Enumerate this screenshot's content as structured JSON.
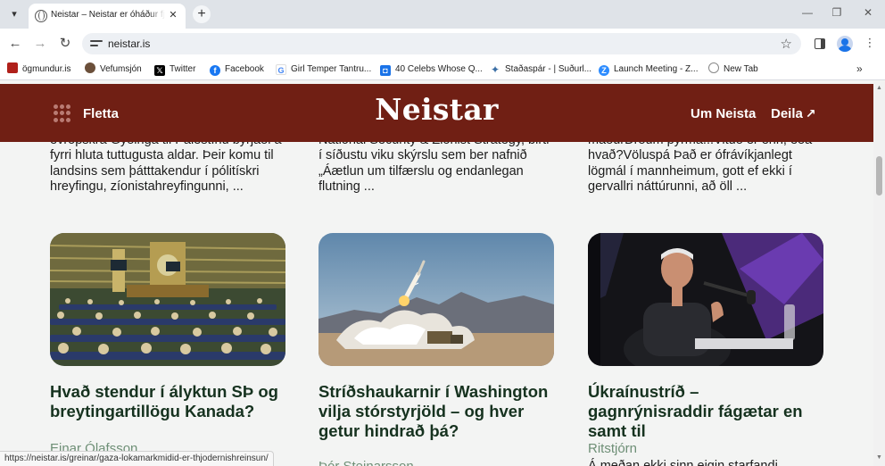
{
  "browser": {
    "tab": {
      "title": "Neistar – Neistar er óháður fjölmiðill"
    },
    "address": {
      "url": "neistar.is"
    },
    "bookmarks": [
      {
        "label": "ögmundur.is",
        "icon": "ogmundur-favicon",
        "color": "#b0201a"
      },
      {
        "label": "Vefumsjón",
        "icon": "person-avatar-favicon",
        "color": "#6b4f3a"
      },
      {
        "label": "Twitter",
        "icon": "x-favicon",
        "color": "#000000"
      },
      {
        "label": "Facebook",
        "icon": "facebook-favicon",
        "color": "#1877f2"
      },
      {
        "label": "Girl Temper Tantru...",
        "icon": "google-favicon",
        "color": "#4285f4"
      },
      {
        "label": "40 Celebs Whose Q...",
        "icon": "blue-square-favicon",
        "color": "#1a73e8"
      },
      {
        "label": "Staðaspár - | Suðurl...",
        "icon": "sparkle-favicon",
        "color": "#3a6ea5"
      },
      {
        "label": "Launch Meeting - Z...",
        "icon": "zoom-favicon",
        "color": "#2d8cff"
      },
      {
        "label": "New Tab",
        "icon": "globe-favicon",
        "color": "#555555"
      }
    ],
    "status_url": "https://neistar.is/greinar/gaza-lokamarkmidid-er-thjodernishreinsun/"
  },
  "site": {
    "brand": "Neistar",
    "menu_label": "Fletta",
    "about_label": "Um Neista",
    "share_label": "Deila",
    "header_color": "#701f14"
  },
  "articles": {
    "top": [
      {
        "excerpt": "evrópskra Gyðinga til Palestínu byrjaði á fyrri hluta tuttugusta aldar. Þeir komu til landsins sem þátttakendur í pólitískri hreyfingu, zíonistahreyfingunni, ..."
      },
      {
        "excerpt": "National Security & Zionist Strategy, birti í síðustu viku skýrslu sem ber nafnið „Áætlun um tilfærslu og endanlegan flutning ..."
      },
      {
        "excerpt": "maðurDrðum þyrma...Vituð er enn, eða hvað?Völuspá Það er ófrávíkjanlegt lögmál í mannheimum, gott ef ekki í gervallri náttúrunni, að öll ..."
      }
    ],
    "cards": [
      {
        "title": "Hvað stendur í ályktun SÞ og breytingartillögu Kanada?",
        "author": "Einar Ólafsson",
        "image": "un-general-assembly-photo"
      },
      {
        "title": "Stríðshaukarnir í Washington vilja stórstyrjöld – og hver getur hindrað þá?",
        "author": "Þór Steinarsson",
        "image": "missile-launch-photo"
      },
      {
        "title": "Úkraínustríð – gagnrýnisraddir fágætar en samt til",
        "author": "Ritstjórn",
        "excerpt_start": "Á meðan ekki sinn eigin starfandi",
        "image": "podcast-speaker-photo"
      }
    ]
  }
}
